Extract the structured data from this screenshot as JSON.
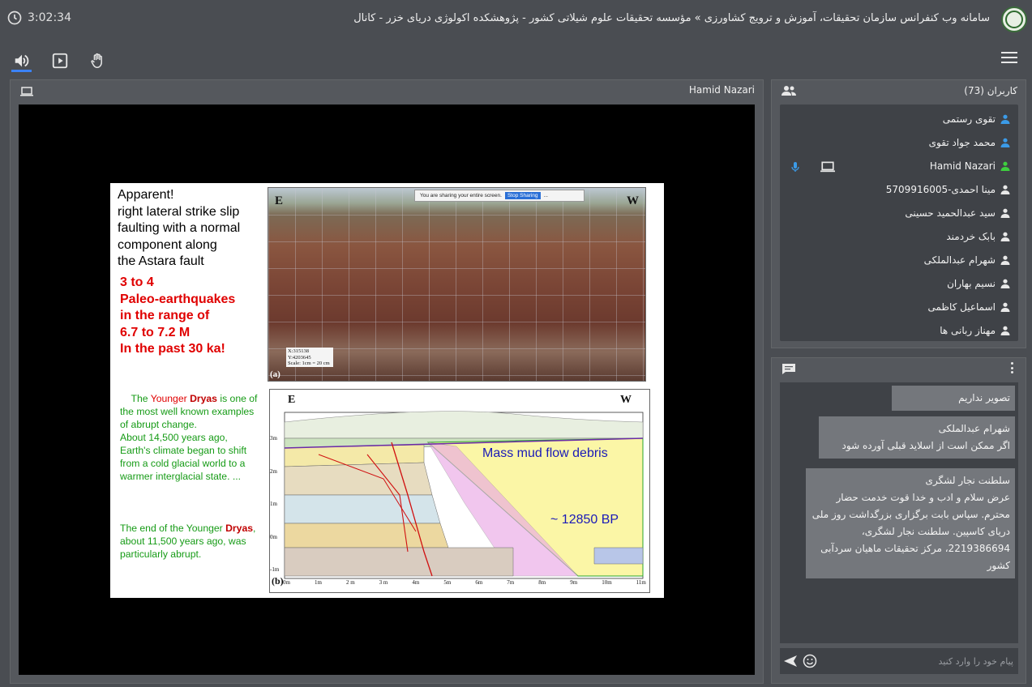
{
  "topbar": {
    "timer": "3:02:34",
    "title": "سامانه وب کنفرانس سازمان تحقیقات، آموزش و ترویج کشاورزی » مؤسسه تحقیقات علوم شیلاتی کشور - پژوهشکده اکولوژی دریای خزر - کانال"
  },
  "screen_share": {
    "presenter": "Hamid Nazari",
    "slide": {
      "heading_black": "Apparent!\nright lateral strike slip\nfaulting with a normal\ncomponent  along\nthe Astara fault",
      "heading_red": "3 to 4\nPaleo-earthquakes\nin the range of\n6.7 to 7.2 M\nIn the past 30 ka!",
      "green_p1_a": "The ",
      "green_p1_red": "Younger ",
      "green_p1_bold": "Dryas",
      "green_p1_b": " is one of the most well known examples of abrupt change.",
      "green_p2": "About 14,500 years ago, Earth's climate began to shift from a cold glacial world to a warmer interglacial state. ...",
      "green_p3_a": "The end of the Younger ",
      "green_p3_bold": "Dryas",
      "green_p3_b": ", about 11,500 years ago, was particularly abrupt.",
      "photo_e": "E",
      "photo_w": "W",
      "share_notice": "You are sharing your entire screen.",
      "share_stop": "Stop Sharing",
      "share_more": "...",
      "coords": "X:315138\nY:4203645\nScale: 1cm = 20 cm",
      "photo_label": "(a)",
      "diagram_label": "(b)",
      "diagram_e": "E",
      "diagram_w": "W",
      "diagram_text1": "Mass mud flow debris",
      "diagram_text2": "~ 12850 BP",
      "x_ticks": [
        "0m",
        "1m",
        "2 m",
        "3 m",
        "4m",
        "5m",
        "6m",
        "7m",
        "8m",
        "9m",
        "10m",
        "11m"
      ],
      "y_ticks": [
        "3m",
        "2m",
        "1m",
        "0m",
        "-1m"
      ]
    }
  },
  "users": {
    "title": "کاربران (73)",
    "items": [
      {
        "name": "تقوی رستمی",
        "color": "#3b9be8"
      },
      {
        "name": "محمد جواد تقوی",
        "color": "#3b9be8"
      },
      {
        "name": "Hamid Nazari",
        "color": "#3ecf3e"
      },
      {
        "name": "مینا احمدی-5709916005",
        "color": "#e8e8e8"
      },
      {
        "name": "سید عبدالحمید حسینی",
        "color": "#e8e8e8"
      },
      {
        "name": "بابک خردمند",
        "color": "#e8e8e8"
      },
      {
        "name": "شهرام عبدالملکی",
        "color": "#e8e8e8"
      },
      {
        "name": "نسیم بهاران",
        "color": "#e8e8e8"
      },
      {
        "name": "اسماعیل کاظمی",
        "color": "#e8e8e8"
      },
      {
        "name": "مهناز ربانی ها",
        "color": "#e8e8e8"
      }
    ]
  },
  "chat": {
    "messages": [
      {
        "author": "",
        "text": "تصویر نداریم"
      },
      {
        "author": "شهرام عبدالملکی",
        "text": "اگر ممکن است از اسلاید قبلی آورده شود"
      },
      {
        "author": "سلطنت نجار لشگری",
        "text": "عرض سلام و ادب و خدا قوت خدمت حضار محترم. سپاس بابت برگزاری بزرگداشت روز ملی دریای کاسپین. سلطنت نجار لشگری، 2219386694، مرکز تحقیقات ماهیان سردآبی کشور"
      }
    ],
    "input_placeholder": "پیام خود را وارد کنید"
  }
}
